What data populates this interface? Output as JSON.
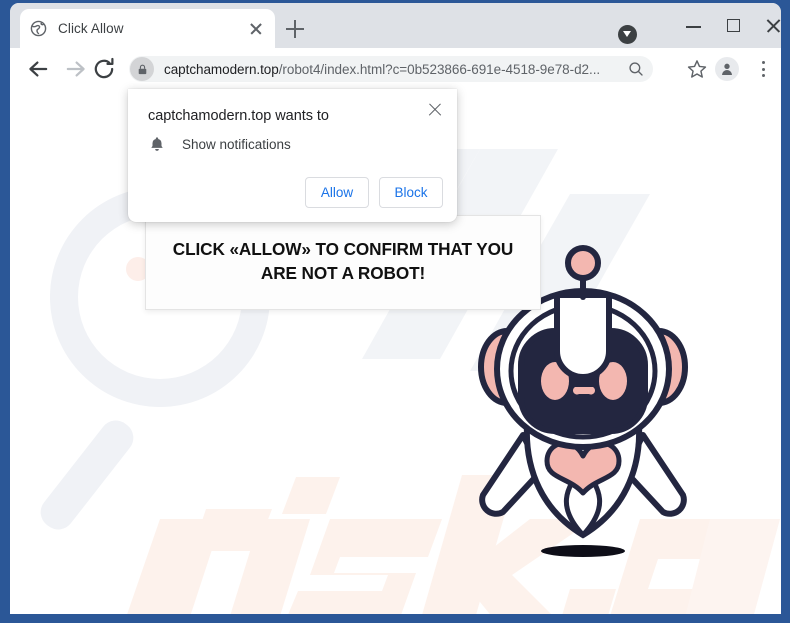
{
  "window": {
    "controls": {
      "minimize": "minimize",
      "maximize": "maximize",
      "close": "close"
    },
    "frame_color": "#2b5797"
  },
  "browser": {
    "tab": {
      "title": "Click Allow",
      "favicon": "globe-icon",
      "close_label": "close-tab"
    },
    "new_tab_label": "New tab",
    "toolbar": {
      "back_label": "Back",
      "forward_label": "Forward",
      "reload_label": "Reload",
      "search_label": "Search",
      "bookmark_label": "Bookmark this tab",
      "profile_label": "Profile",
      "menu_label": "Customize and control Google Chrome"
    },
    "omnibox": {
      "security_icon": "lock-icon",
      "url_host": "captchamodern.top",
      "url_path": "/robot4/index.html?c=0b523866-691e-4518-9e78-d2...",
      "full_url": "captchamodern.top/robot4/index.html?c=0b523866-691e-4518-9e78-d2..."
    },
    "download_indicator": "download-icon"
  },
  "permission_dialog": {
    "title": "captchamodern.top wants to",
    "request_icon": "bell-icon",
    "request_label": "Show notifications",
    "allow_label": "Allow",
    "block_label": "Block",
    "close_label": "Close",
    "accent_color": "#1a73e8"
  },
  "page": {
    "speech_bubble": {
      "line1": "CLICK «ALLOW» TO CONFIRM THAT YOU",
      "line2": "ARE NOT A ROBOT!",
      "text": "CLICK «ALLOW» TO CONFIRM THAT YOU ARE NOT A ROBOT!"
    },
    "mascot": {
      "name": "robot-mascot",
      "outline_color": "#232640",
      "accent_color": "#f3b7b0",
      "body_color": "#ffffff"
    },
    "watermark": {
      "text": "risk.com",
      "logo": "magnifier-pc-logo",
      "color": "#fdf3ef"
    },
    "background_color": "#ffffff"
  }
}
